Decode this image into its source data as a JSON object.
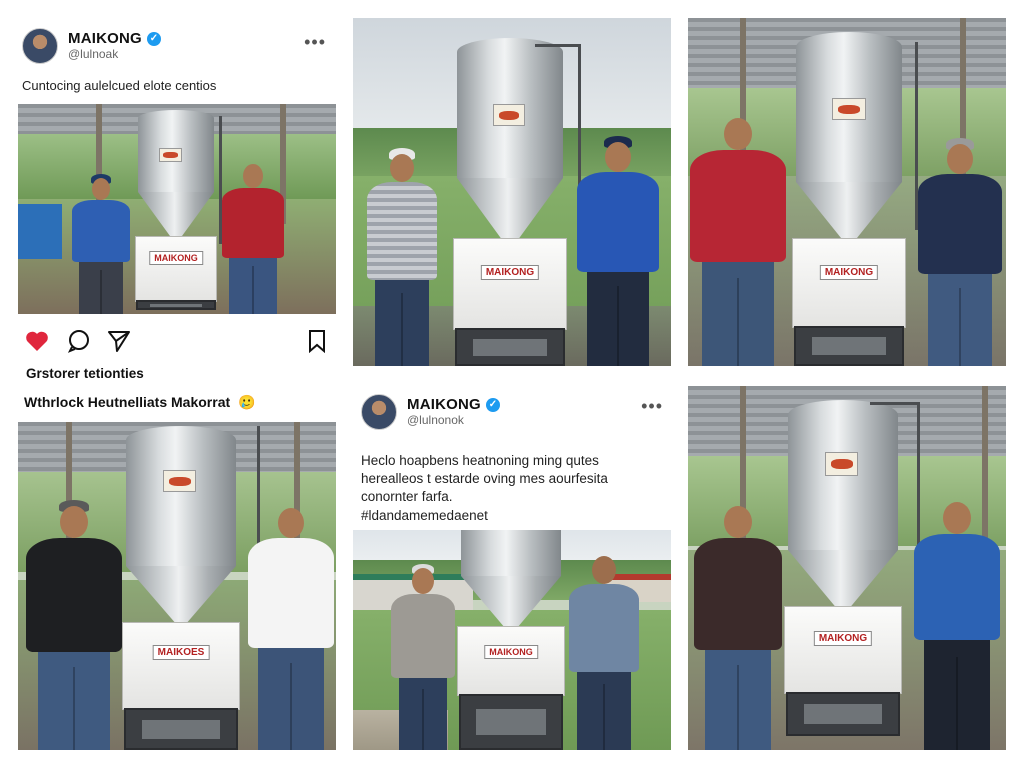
{
  "post_top_left": {
    "name": "MAIKONG",
    "handle": "@lulnoak",
    "more": "•••",
    "caption": "Cuntocing aulelcued elote centios"
  },
  "post_top_left_actions": {
    "icons": [
      "heart-icon",
      "comment-icon",
      "share-icon",
      "bookmark-icon"
    ]
  },
  "mid_left": {
    "line1": "Grstorer tetionties",
    "line2": "Wthrlock Heutnelliats Makorrat",
    "emoji": "🥲"
  },
  "post_mid_center": {
    "name": "MAIKONG",
    "handle": "@lulnonok",
    "more": "•••",
    "caption_lines": [
      "Heclo hoapbens heatnoning ming qutes",
      "herealleos t estarde oving mes aourfesita",
      "conornter farfa.",
      "#ldandamemedaenet"
    ]
  },
  "machine_labels": {
    "a": "MAIKONG",
    "b": "MAIKONG",
    "c": "MAIKONG",
    "d": "MAIKOES",
    "e": "MAIKONG",
    "f": "MAIKONG"
  },
  "colors": {
    "like_red": "#e0263d",
    "verified_blue": "#1d9bf0"
  }
}
